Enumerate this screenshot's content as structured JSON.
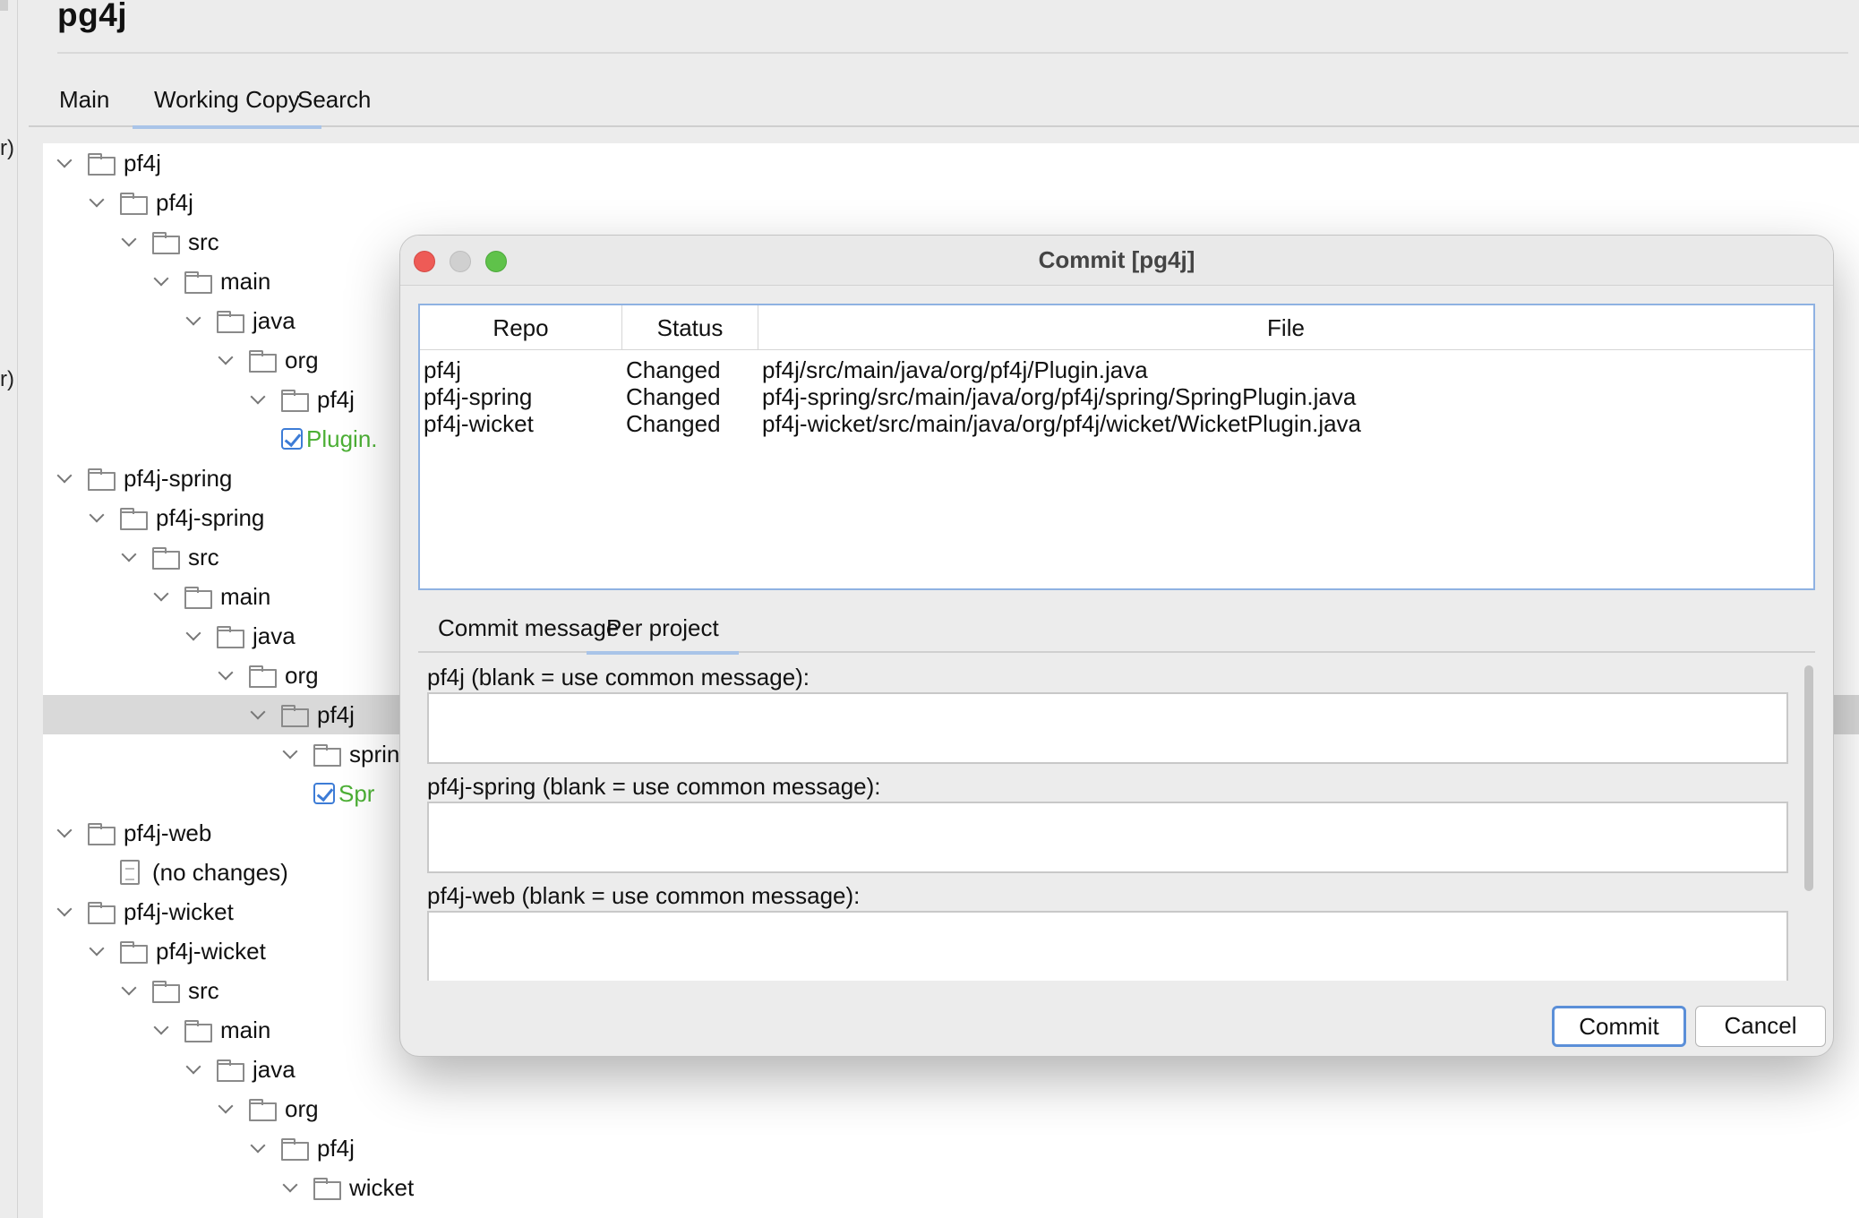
{
  "app": {
    "title": "pg4j",
    "tabs": [
      {
        "label": "Main"
      },
      {
        "label": "Working Copy"
      },
      {
        "label": "Search"
      }
    ]
  },
  "gutter": {
    "fragments": [
      "r)",
      "r)"
    ]
  },
  "tree": {
    "rows": [
      {
        "label": "pf4j",
        "depth": 0,
        "kind": "folder"
      },
      {
        "label": "pf4j",
        "depth": 1,
        "kind": "folder"
      },
      {
        "label": "src",
        "depth": 2,
        "kind": "folder"
      },
      {
        "label": "main",
        "depth": 3,
        "kind": "folder"
      },
      {
        "label": "java",
        "depth": 4,
        "kind": "folder"
      },
      {
        "label": "org",
        "depth": 5,
        "kind": "folder"
      },
      {
        "label": "pf4j",
        "depth": 6,
        "kind": "folder"
      },
      {
        "label": "Plugin.",
        "depth": 7,
        "kind": "file-checked"
      },
      {
        "label": "pf4j-spring",
        "depth": 0,
        "kind": "folder"
      },
      {
        "label": "pf4j-spring",
        "depth": 1,
        "kind": "folder"
      },
      {
        "label": "src",
        "depth": 2,
        "kind": "folder"
      },
      {
        "label": "main",
        "depth": 3,
        "kind": "folder"
      },
      {
        "label": "java",
        "depth": 4,
        "kind": "folder"
      },
      {
        "label": "org",
        "depth": 5,
        "kind": "folder"
      },
      {
        "label": "pf4j",
        "depth": 6,
        "kind": "folder",
        "selected": true
      },
      {
        "label": "spring",
        "depth": 7,
        "kind": "folder"
      },
      {
        "label": "Spr",
        "depth": 8,
        "kind": "file-checked"
      },
      {
        "label": "pf4j-web",
        "depth": 0,
        "kind": "folder"
      },
      {
        "label": "(no changes)",
        "depth": 1,
        "kind": "doc"
      },
      {
        "label": "pf4j-wicket",
        "depth": 0,
        "kind": "folder"
      },
      {
        "label": "pf4j-wicket",
        "depth": 1,
        "kind": "folder"
      },
      {
        "label": "src",
        "depth": 2,
        "kind": "folder"
      },
      {
        "label": "main",
        "depth": 3,
        "kind": "folder"
      },
      {
        "label": "java",
        "depth": 4,
        "kind": "folder"
      },
      {
        "label": "org",
        "depth": 5,
        "kind": "folder"
      },
      {
        "label": "pf4j",
        "depth": 6,
        "kind": "folder"
      },
      {
        "label": "wicket",
        "depth": 7,
        "kind": "folder"
      }
    ]
  },
  "dialog": {
    "title": "Commit [pg4j]",
    "table": {
      "headers": [
        "Repo",
        "Status",
        "File"
      ],
      "rows": [
        {
          "repo": "pf4j",
          "status": "Changed",
          "file": "pf4j/src/main/java/org/pf4j/Plugin.java"
        },
        {
          "repo": "pf4j-spring",
          "status": "Changed",
          "file": "pf4j-spring/src/main/java/org/pf4j/spring/SpringPlugin.java"
        },
        {
          "repo": "pf4j-wicket",
          "status": "Changed",
          "file": "pf4j-wicket/src/main/java/org/pf4j/wicket/WicketPlugin.java"
        }
      ]
    },
    "tabs": [
      {
        "label": "Commit message"
      },
      {
        "label": "Per project"
      }
    ],
    "per_project": [
      {
        "label": "pf4j (blank = use common message):",
        "value": ""
      },
      {
        "label": "pf4j-spring (blank = use common message):",
        "value": ""
      },
      {
        "label": "pf4j-web (blank = use common message):",
        "value": ""
      }
    ],
    "commit_label": "Commit",
    "cancel_label": "Cancel"
  },
  "colors": {
    "accent": "#5b8fd8",
    "tab_underline": "#a9c4e8",
    "changed_file": "#4caf35",
    "close": "#ee5b56",
    "zoom": "#5fc24a"
  }
}
